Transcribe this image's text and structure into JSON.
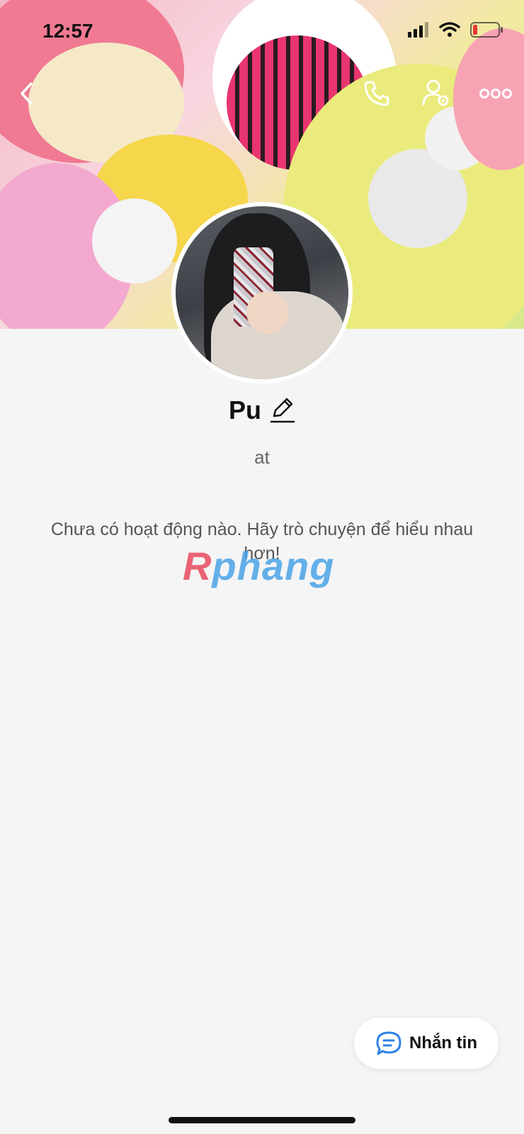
{
  "status_bar": {
    "time": "12:57",
    "icons": [
      "cellular-signal-icon",
      "wifi-icon",
      "battery-icon"
    ]
  },
  "top_nav": {
    "icons": [
      "back-icon",
      "phone-call-icon",
      "profile-settings-icon",
      "more-icon"
    ]
  },
  "profile": {
    "name": "Pu",
    "subtitle": "at",
    "edit_icon": "pencil-icon"
  },
  "feed": {
    "empty_message": "Chưa có hoạt động nào. Hãy trò chuyện để hiểu nhau hơn!"
  },
  "watermark": {
    "text_first": "R",
    "text_rest": "phang"
  },
  "actions": {
    "message_label": "Nhắn tin",
    "message_icon": "chat-bubble-icon"
  },
  "colors": {
    "accent": "#2e82e6",
    "battery_low": "#e53935"
  }
}
